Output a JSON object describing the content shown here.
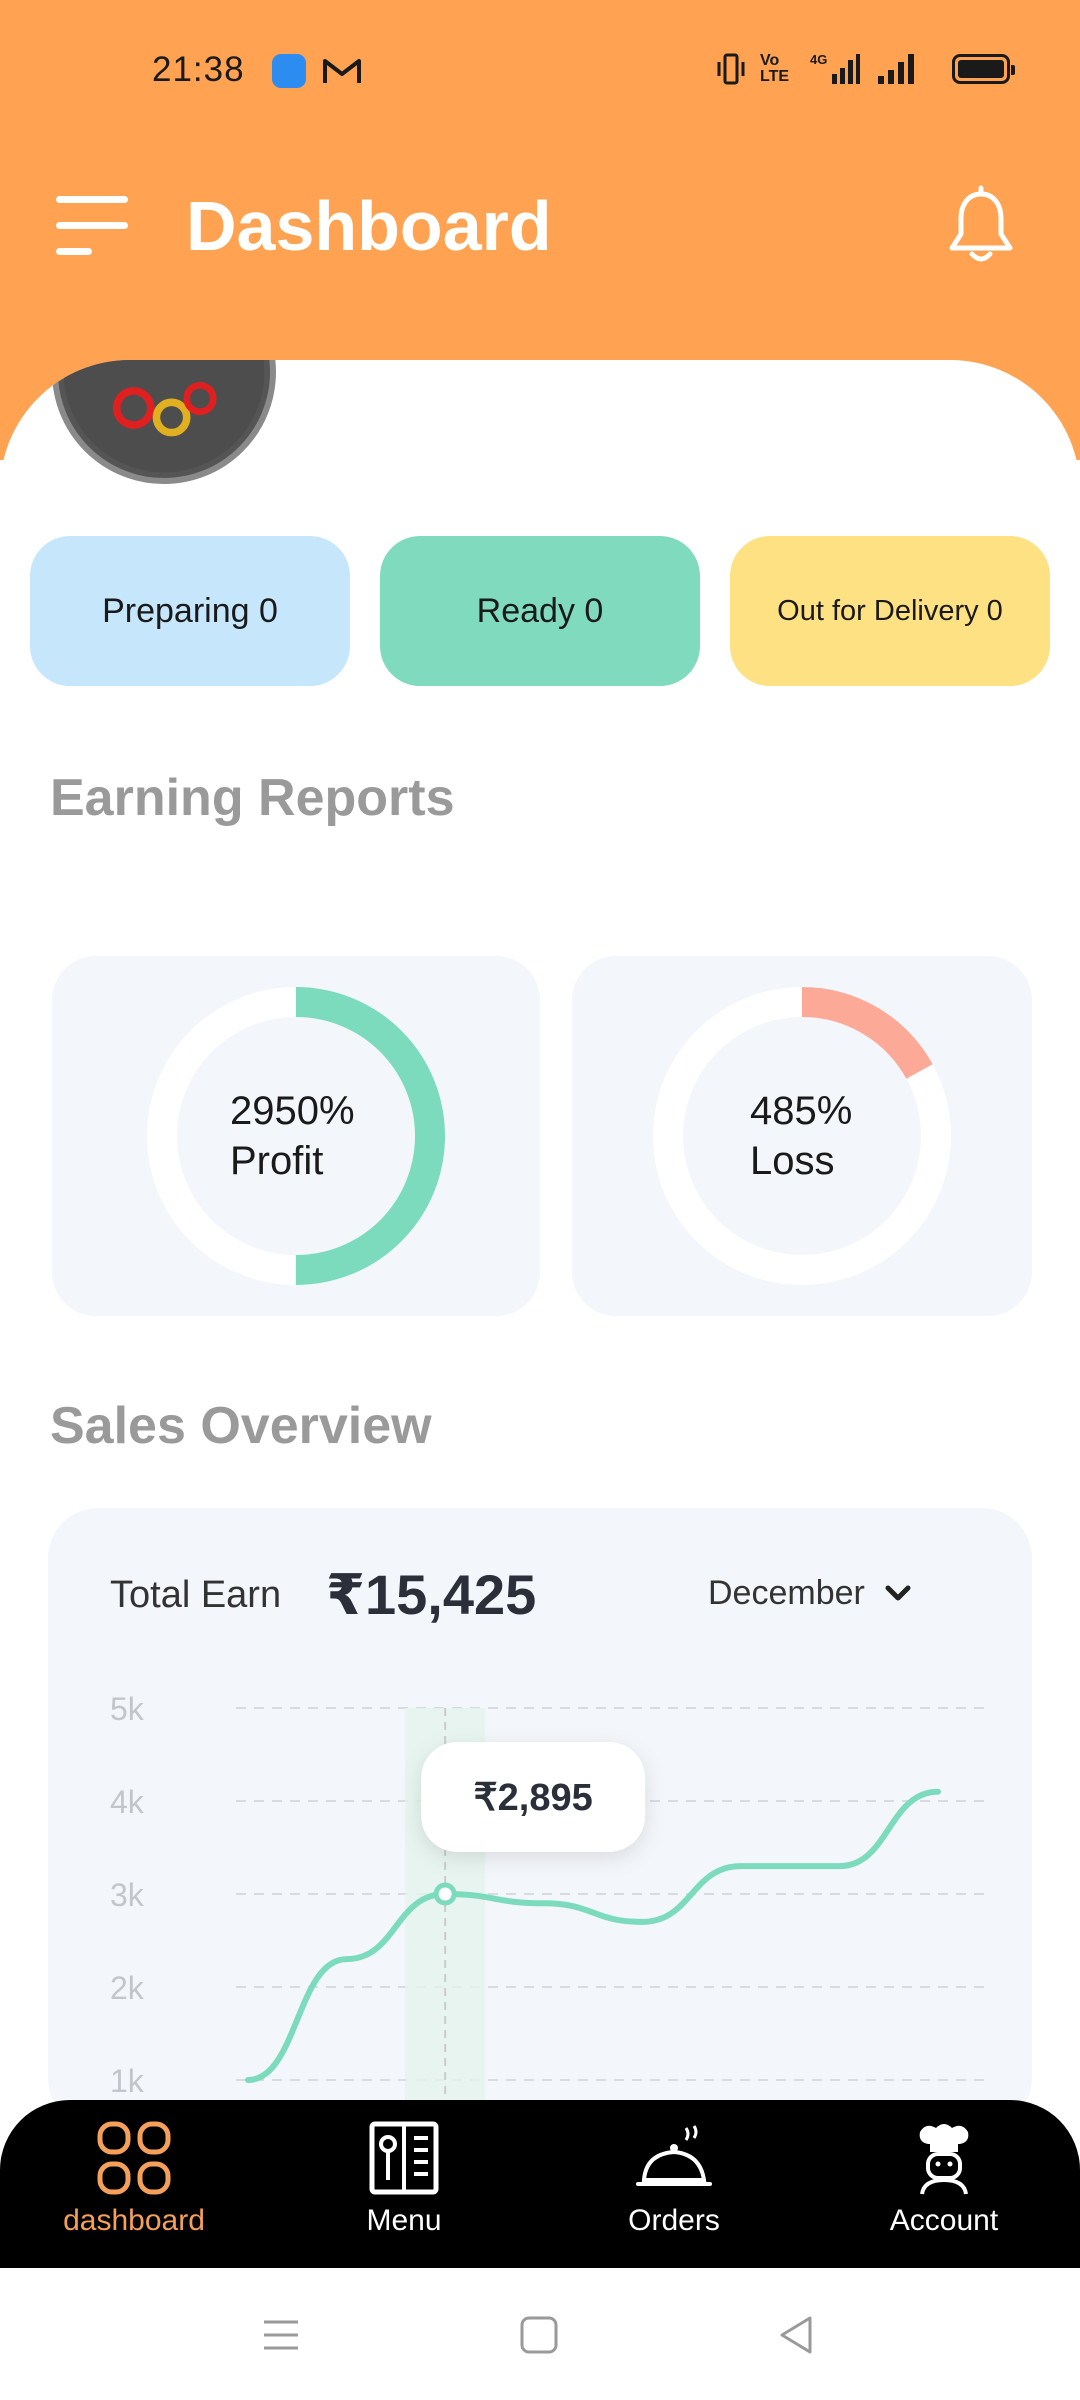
{
  "status_bar": {
    "time": "21:38",
    "icons": [
      "paytm-icon",
      "gmail-icon",
      "vibrate-icon",
      "volte-icon",
      "signal-4g-icon",
      "signal-icon",
      "battery-icon"
    ],
    "volte_text": "Vo\nLTE",
    "network_text": "4G"
  },
  "header": {
    "title": "Dashboard",
    "background_color": "#FFA352"
  },
  "order_status": [
    {
      "label": "Preparing 0",
      "color": "#C6E6FC"
    },
    {
      "label": "Ready 0",
      "color": "#80DBBE"
    },
    {
      "label": "Out for Delivery 0",
      "color": "#FDE183"
    }
  ],
  "earning_reports": {
    "title": "Earning Reports",
    "profit": {
      "value": "2950%",
      "label": "Profit",
      "color": "#7DDBBD",
      "fraction": 0.5
    },
    "loss": {
      "value": "485%",
      "label": "Loss",
      "color": "#FCAA97",
      "fraction": 0.17
    }
  },
  "sales_overview": {
    "title": "Sales Overview",
    "total_earn_label": "Total Earn",
    "total_earn_value": "₹15,425",
    "month": "December",
    "tooltip_value": "₹2,895"
  },
  "chart_data": {
    "type": "line",
    "y_tick_labels": [
      "5k",
      "4k",
      "3k",
      "2k",
      "1k"
    ],
    "ylim": [
      1000,
      5000
    ],
    "x": [
      0,
      1,
      2,
      3,
      4,
      5,
      6,
      7
    ],
    "values": [
      1000,
      2300,
      3000,
      2900,
      2700,
      3300,
      3300,
      4100
    ],
    "highlight_index": 2,
    "line_color": "#7DDBBD",
    "grid": true
  },
  "bottom_nav": [
    {
      "label": "dashboard",
      "icon": "dashboard-grid-icon",
      "active": true
    },
    {
      "label": "Menu",
      "icon": "menu-book-icon",
      "active": false
    },
    {
      "label": "Orders",
      "icon": "cloche-icon",
      "active": false
    },
    {
      "label": "Account",
      "icon": "chef-icon",
      "active": false
    }
  ],
  "accent_color": "#F5A05A"
}
